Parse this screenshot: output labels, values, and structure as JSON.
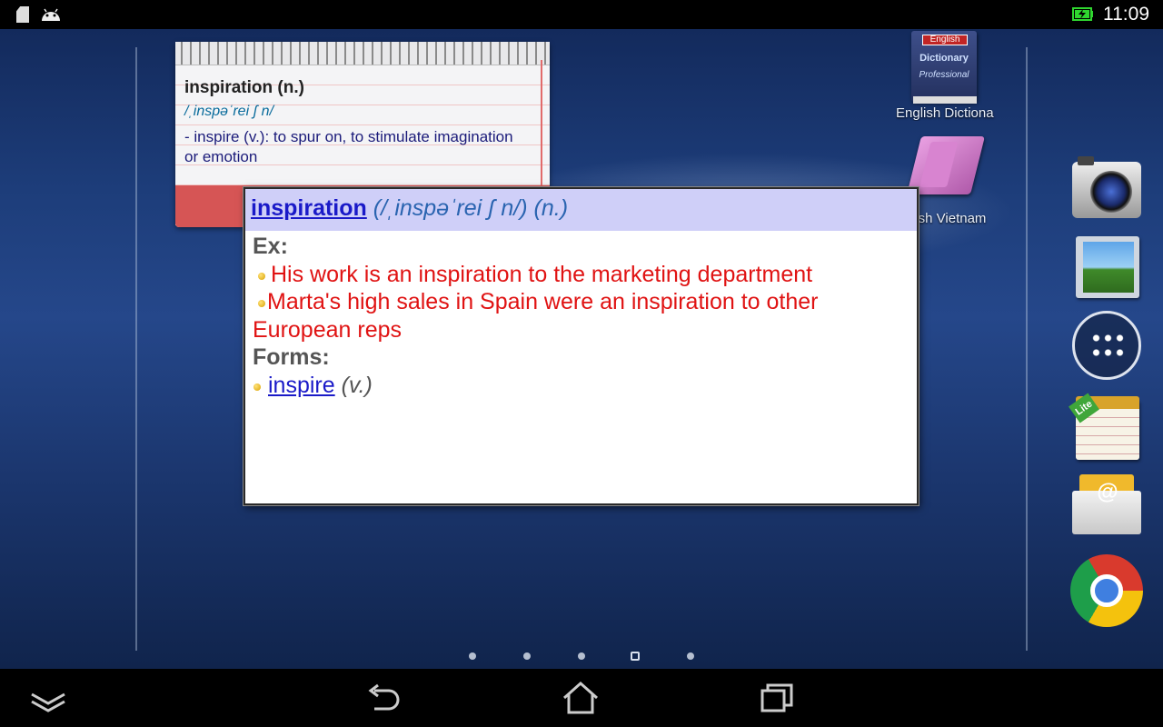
{
  "status_bar": {
    "time": "11:09",
    "icons": [
      "sd-card-icon",
      "android-icon",
      "battery-charging-icon"
    ]
  },
  "notepad_widget": {
    "word": "inspiration (n.)",
    "pronunciation": "/ˌinspəˈrei ʃ n/",
    "definition": " - inspire (v.): to spur on, to stimulate imagination or emotion"
  },
  "desktop_shortcuts": [
    {
      "label": "English Dictiona",
      "icon": "english-dictionary-icon",
      "book_tag": "English",
      "book_title": "Dictionary",
      "book_subtitle": "Professional"
    },
    {
      "label": "lish Vietnam",
      "icon": "english-vietnamese-icon"
    }
  ],
  "dock": [
    {
      "icon": "camera-icon"
    },
    {
      "icon": "gallery-icon"
    },
    {
      "icon": "apps-grid-icon"
    },
    {
      "icon": "notes-lite-icon",
      "badge": "Lite"
    },
    {
      "icon": "email-icon"
    },
    {
      "icon": "chrome-icon"
    }
  ],
  "page_indicator": {
    "count": 5,
    "active_index": 3
  },
  "popup": {
    "headword": "inspiration",
    "pronunciation": "(/ˌinspəˈrei ʃ n/)",
    "pos": "(n.)",
    "examples_label": "Ex:",
    "examples": [
      "His work is an inspiration to the marketing department",
      "Marta's high sales in Spain were an inspiration to other European reps"
    ],
    "forms_label": "Forms:",
    "forms": [
      {
        "word": "inspire",
        "pos": "(v.)"
      }
    ]
  },
  "nav_bar": {
    "buttons": [
      "hide-keyboard-icon",
      "back-icon",
      "home-icon",
      "recent-apps-icon"
    ]
  },
  "colors": {
    "popup_header_bg": "#cfcff8",
    "example_text": "#e01313",
    "link": "#1a1ac8"
  }
}
